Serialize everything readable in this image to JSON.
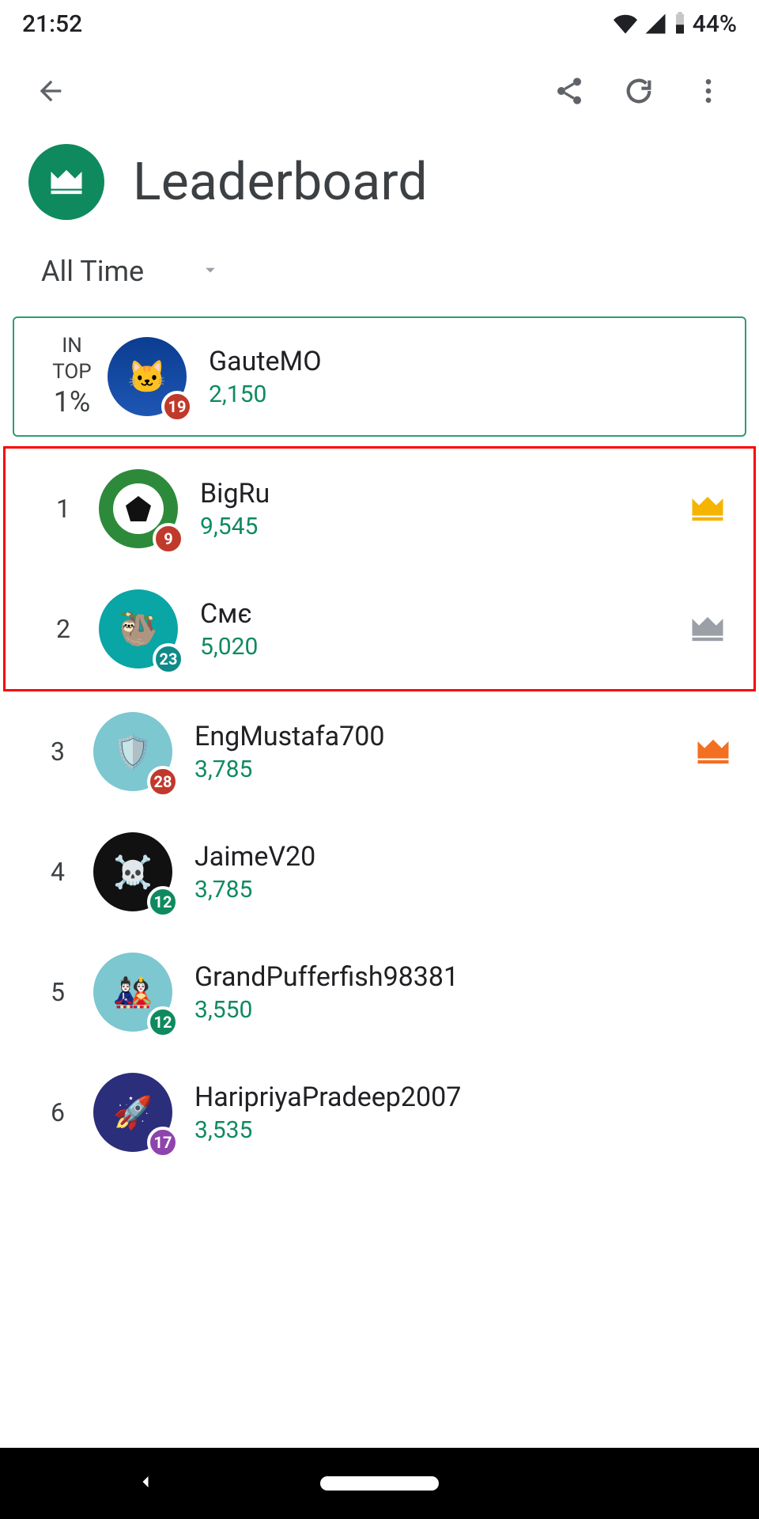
{
  "status": {
    "time": "21:52",
    "battery_pct": "44%"
  },
  "header": {
    "title": "Leaderboard"
  },
  "filter": {
    "selected": "All Time"
  },
  "me": {
    "rank_line1": "IN",
    "rank_line2": "TOP",
    "rank_line3": "1%",
    "name": "GauteMO",
    "score": "2,150",
    "level": "19",
    "level_color": "#c0392b",
    "avatar_color_class": "av-0",
    "avatar_glyph": "🐱"
  },
  "rows": [
    {
      "rank": "1",
      "name": "BigRu",
      "score": "9,545",
      "level": "9",
      "level_color": "#c0392b",
      "avatar_color_class": "av-1",
      "avatar_inner": "soccer",
      "medal": "gold"
    },
    {
      "rank": "2",
      "name": "Смє",
      "score": "5,020",
      "level": "23",
      "level_color": "#0f8a8a",
      "avatar_color_class": "av-2",
      "avatar_glyph": "🦥",
      "medal": "silver"
    },
    {
      "rank": "3",
      "name": "EngMustafa700",
      "score": "3,785",
      "level": "28",
      "level_color": "#c0392b",
      "avatar_color_class": "av-3",
      "avatar_glyph": "🛡️",
      "medal": "bronze"
    },
    {
      "rank": "4",
      "name": "JaimeV20",
      "score": "3,785",
      "level": "12",
      "level_color": "#0f8a5f",
      "avatar_color_class": "av-4",
      "avatar_glyph": "☠️"
    },
    {
      "rank": "5",
      "name": "GrandPufferfish98381",
      "score": "3,550",
      "level": "12",
      "level_color": "#0f8a5f",
      "avatar_color_class": "av-5",
      "avatar_glyph": "🎎"
    },
    {
      "rank": "6",
      "name": "HaripriyaPradeep2007",
      "score": "3,535",
      "level": "17",
      "level_color": "#8e44ad",
      "avatar_color_class": "av-6",
      "avatar_glyph": "🚀"
    }
  ],
  "medal_colors": {
    "gold": "#f5b400",
    "silver": "#9aa0a6",
    "bronze": "#f36f21"
  },
  "highlight_rows": [
    0,
    1
  ]
}
